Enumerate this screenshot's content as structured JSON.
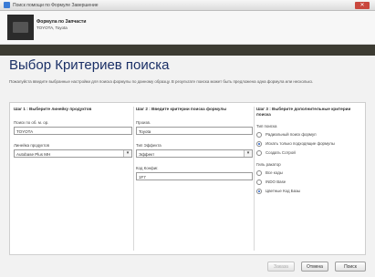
{
  "window": {
    "title": "Поиск помощи по Формуле Завершение",
    "close_label": "✕"
  },
  "header": {
    "title": "Формула по Запчасти",
    "subtitle": "TOYOTA, Toyota"
  },
  "page": {
    "title": "Выбор Критериев поиска",
    "description": "Пожалуйста введите выбранные настройки для поиска формулы по данному образцу. В результате поиска может быть предложена одна формула или несколько."
  },
  "step1": {
    "heading": "Шаг 1 : Выберите линейку продуктов",
    "manufacturer_label": "Поиск по об. м. ор.",
    "manufacturer_value": "TOYOTA",
    "product_line_label": "Линейка продуктов",
    "product_line_value": "Autobase Plus MH"
  },
  "step2": {
    "heading": "Шаг 2 : Введите критерии поиска формулы",
    "field1_label": "Произв.",
    "field1_value": "Toyota",
    "field2_label": "Тип Эффекта",
    "field2_value": "Эффект",
    "field3_label": "Код Конфиг.",
    "field3_value": "1F7"
  },
  "step3": {
    "heading": "Шаг 3 : Выберите дополнительные критерии поиска",
    "group1_label": "Тип поиска",
    "group1_options": [
      {
        "label": "Радиальный поиск формул",
        "selected": false
      },
      {
        "label": "Искать только подходящие формулы",
        "selected": true
      },
      {
        "label": "Создать Сотрой",
        "selected": false
      }
    ],
    "group2_label": "Гиль ракатор",
    "group2_options": [
      {
        "label": "Все коды",
        "selected": false
      },
      {
        "label": "INDO Base",
        "selected": false
      },
      {
        "label": "Цветные Код Базы",
        "selected": true
      }
    ]
  },
  "footer": {
    "search_label": "Заказа",
    "cancel_label": "Отмена",
    "next_label": "Поиск"
  }
}
